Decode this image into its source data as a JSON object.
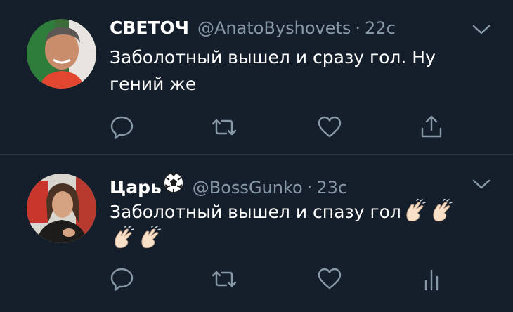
{
  "tweets": [
    {
      "name": "СВЕТОЧ",
      "handle": "@AnatoByshovets",
      "separator": "·",
      "time": "22с",
      "text": "Заболотный вышел и сразу гол. Ну гений же",
      "last_action_icon": "share-icon"
    },
    {
      "name": "Царь",
      "name_emoji": "soccer-ball-icon",
      "handle": "@BossGunko",
      "separator": "·",
      "time": "23с",
      "text": "Заболотный вышел и спазу гол",
      "trailing_emoji": [
        "clapping-hands-icon",
        "clapping-hands-icon",
        "clapping-hands-icon",
        "clapping-hands-icon"
      ],
      "last_action_icon": "analytics-icon"
    }
  ],
  "colors": {
    "background": "#151f2b",
    "divider": "#2a3441",
    "primary_text": "#ffffff",
    "secondary_text": "#8899a6",
    "icon": "#8899a6"
  }
}
